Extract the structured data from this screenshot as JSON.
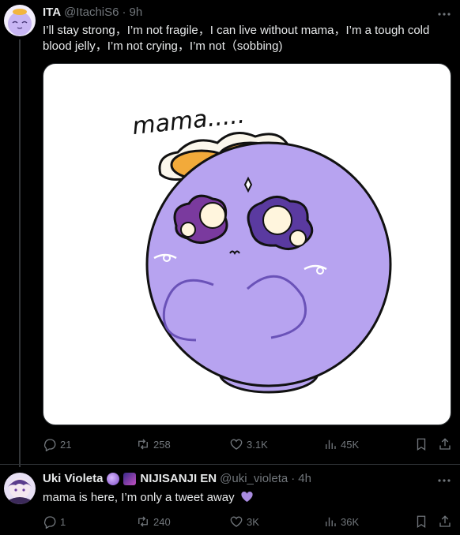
{
  "tweet1": {
    "name": "ITA",
    "handle": "@ItachiS6",
    "time": "9h",
    "text": "I’ll stay strong，I’m not fragile，I can live without mama，I’m a tough cold blood jelly，I’m not crying，I’m not（sobbing)",
    "media_caption": "mama.....",
    "stats": {
      "replies": "21",
      "reposts": "258",
      "likes": "3.1K",
      "views": "45K"
    }
  },
  "tweet2": {
    "name": "Uki Violeta",
    "badge_text": "NIJISANJI EN",
    "handle": "@uki_violeta",
    "time": "4h",
    "text": "mama is here, I’m only a tweet away",
    "stats": {
      "replies": "1",
      "reposts": "240",
      "likes": "3K",
      "views": "36K"
    }
  },
  "icons": {
    "more": "more-dots-icon",
    "reply": "reply-icon",
    "repost": "repost-icon",
    "like": "heart-icon",
    "views": "views-chart-icon",
    "bookmark": "bookmark-icon",
    "share": "share-icon"
  },
  "colors": {
    "background": "#000000",
    "text": "#e7e9ea",
    "muted": "#71767b",
    "jelly": "#b7a3f0",
    "heart": "#a98be0"
  }
}
